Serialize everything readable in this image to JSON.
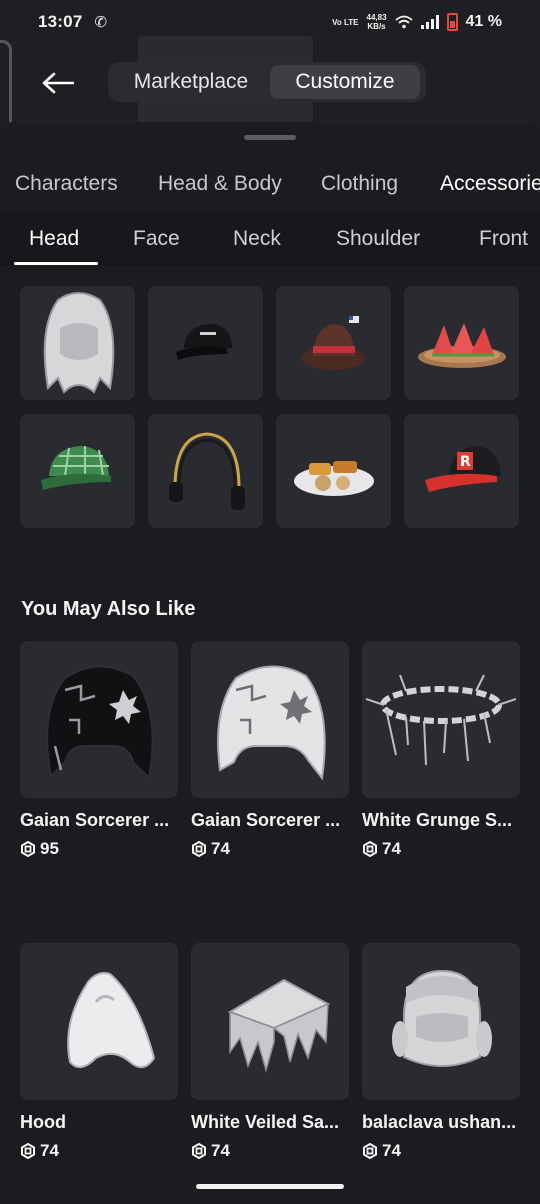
{
  "status": {
    "time": "13:07",
    "network_type": "Vo LTE",
    "speed": "44,83",
    "speed_unit": "KB/s",
    "battery": "41 %"
  },
  "header": {
    "back_icon": "arrow-left-icon",
    "tabs": [
      "Marketplace",
      "Customize"
    ],
    "selected_tab": "Customize"
  },
  "categories": [
    "Characters",
    "Head & Body",
    "Clothing",
    "Accessories"
  ],
  "selected_category": "Accessories",
  "subtabs": [
    "Head",
    "Face",
    "Neck",
    "Shoulder",
    "Front"
  ],
  "selected_subtab": "Head",
  "inventory": [
    "white-hood",
    "black-cap",
    "red-fedora",
    "watermelon-plate",
    "green-plaid-cap",
    "headphones",
    "snack-plate",
    "red-roblox-cap"
  ],
  "recommendations": {
    "title": "You May Also Like",
    "items": [
      {
        "name": "Gaian Sorcerer ...",
        "price": "95",
        "icon": "black-hood"
      },
      {
        "name": "Gaian Sorcerer ...",
        "price": "74",
        "icon": "white-hood"
      },
      {
        "name": "White Grunge S...",
        "price": "74",
        "icon": "spiked-chain-halo"
      },
      {
        "name": "Hood",
        "price": "74",
        "icon": "white-hood-simple"
      },
      {
        "name": "White Veiled Sa...",
        "price": "74",
        "icon": "veiled-hat"
      },
      {
        "name": "balaclava ushan...",
        "price": "74",
        "icon": "ushanka-balaclava"
      }
    ]
  },
  "colors": {
    "background": "#1b1c1f",
    "tile": "#2a2b30",
    "accent": "#ffffff"
  }
}
